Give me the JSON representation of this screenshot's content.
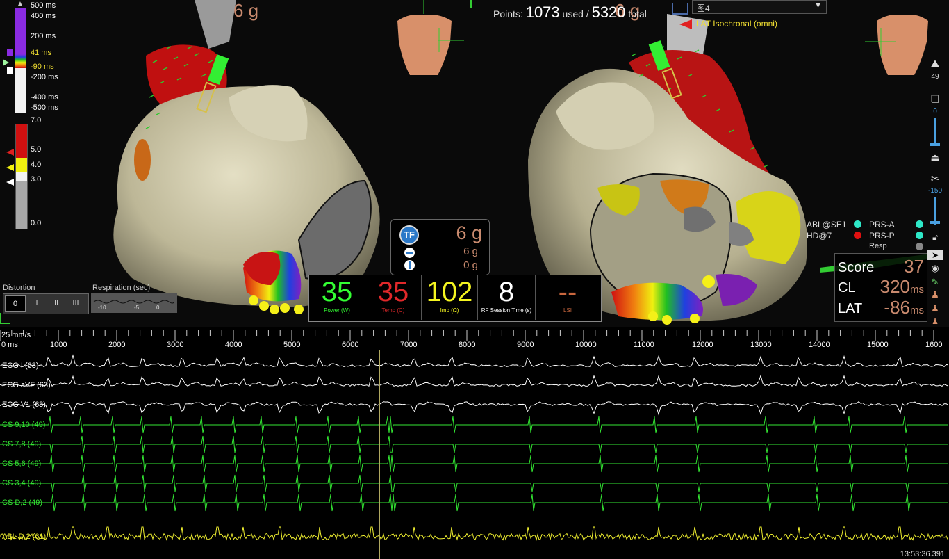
{
  "lat_scale": {
    "ticks": [
      "500 ms",
      "400 ms",
      "200 ms",
      "41 ms",
      "-90 ms",
      "-200 ms",
      "-400 ms",
      "-500 ms"
    ],
    "upper_value": "41 ms",
    "lower_value": "-90 ms"
  },
  "force_scale": {
    "ticks": [
      "7.0",
      "5.0",
      "4.0",
      "3.0",
      "0.0"
    ]
  },
  "top": {
    "gforce_left": "6 g",
    "gforce_right": "6 g",
    "points_label": "Points:",
    "points_used": "1073",
    "used_label": "used /",
    "points_total": "5320",
    "total_label": "total"
  },
  "map_select": {
    "value": "图4",
    "mode": "LAT Isochronal (omni)"
  },
  "right_toolbar": {
    "zoom_value": "49",
    "opacity_value": "0",
    "clip_value": "-150"
  },
  "catheters": {
    "abl": "ABL@SE1",
    "hd": "HD@7",
    "prs_a": "PRS-A",
    "prs_p": "PRS-P",
    "resp": "Resp"
  },
  "score_panel": {
    "score_label": "Score",
    "score_value": "37",
    "cl_label": "CL",
    "cl_value": "320",
    "cl_unit": "ms",
    "lat_label": "LAT",
    "lat_value": "-86",
    "lat_unit": "ms"
  },
  "tf_panel": {
    "badge": "TF",
    "total_force": "6 g",
    "axial_force": "6 g",
    "lateral_force": "0 g"
  },
  "rf_panel": {
    "power_value": "35",
    "power_label": "Power (W)",
    "temp_value": "35",
    "temp_label": "Temp (C)",
    "imp_value": "102",
    "imp_label": "Imp (Ω)",
    "session_value": "8",
    "session_label": "RF Session Time (s)",
    "lsi_value": "--",
    "lsi_label": "LSI"
  },
  "distortion": {
    "label": "Distortion",
    "buttons": [
      "0",
      "I",
      "II",
      "III"
    ]
  },
  "respiration": {
    "label": "Respiration (sec)",
    "ticks": [
      "-10",
      "-5",
      "0"
    ]
  },
  "time_axis": {
    "speed": "25 mm/s",
    "labels": [
      "0 ms",
      "1000",
      "2000",
      "3000",
      "4000",
      "5000",
      "6000",
      "7000",
      "8000",
      "9000",
      "10000",
      "11000",
      "12000",
      "13000",
      "14000",
      "15000",
      "1600"
    ]
  },
  "channels": [
    {
      "label": "ECG I (63)",
      "color": "#ffffff"
    },
    {
      "label": "ECG aVF (63)",
      "color": "#ffffff"
    },
    {
      "label": "ECG V1 (63)",
      "color": "#ffffff"
    },
    {
      "label": "CS 9,10 (49)",
      "color": "#33e633"
    },
    {
      "label": "CS 7,8 (49)",
      "color": "#33e633"
    },
    {
      "label": "CS 5,6 (49)",
      "color": "#33e633"
    },
    {
      "label": "CS 3,4 (49)",
      "color": "#33e633"
    },
    {
      "label": "CS D,2 (49)",
      "color": "#33e633"
    },
    {
      "label": "ABL D,2 (61)",
      "color": "#f0f030"
    }
  ],
  "clock": "13:53:36.391",
  "colors": {
    "heart": "#c9c3a4",
    "force_text": "#c98a6e",
    "power": "#33ff33",
    "temp": "#e0282a",
    "imp": "#f5f520",
    "ecg_green": "#33e633",
    "abl_yellow": "#f0f030"
  }
}
